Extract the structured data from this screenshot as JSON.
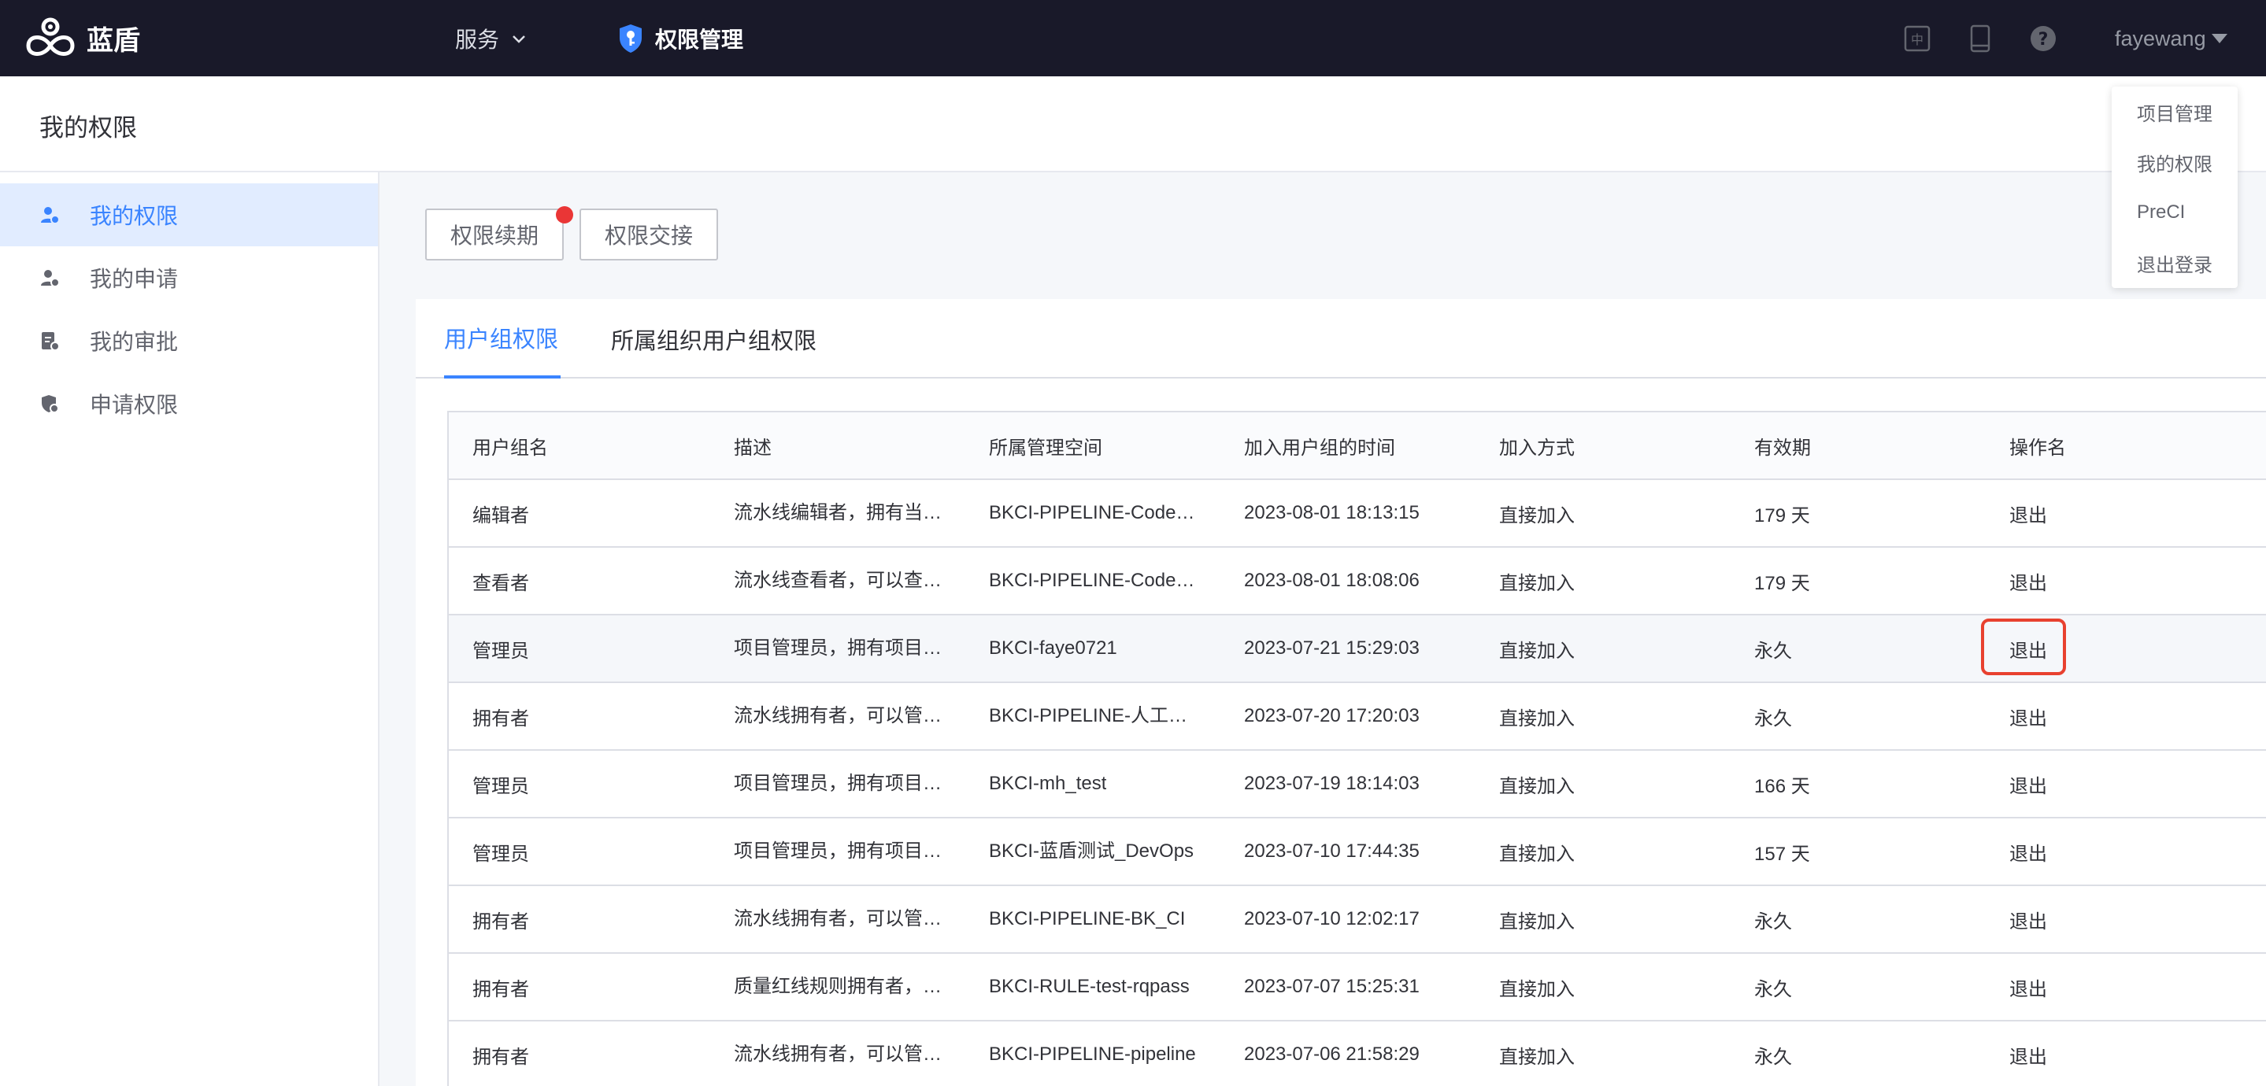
{
  "topbar": {
    "brand_name": "蓝盾",
    "service_label": "服务",
    "module_title": "权限管理",
    "icons": [
      "language-icon",
      "mobile-icon",
      "help-icon"
    ],
    "username": "fayewang"
  },
  "user_dropdown": {
    "items": [
      "项目管理",
      "我的权限",
      "PreCI",
      "退出登录"
    ]
  },
  "header": {
    "title": "我的权限"
  },
  "sidebar": {
    "items": [
      {
        "label": "我的权限",
        "icon": "user-shield-icon",
        "active": true
      },
      {
        "label": "我的申请",
        "icon": "user-apply-icon",
        "active": false
      },
      {
        "label": "我的审批",
        "icon": "approval-doc-icon",
        "active": false
      },
      {
        "label": "申请权限",
        "icon": "lock-shield-icon",
        "active": false
      }
    ]
  },
  "actions": {
    "renew_label": "权限续期",
    "handover_label": "权限交接"
  },
  "tabs": [
    {
      "label": "用户组权限",
      "active": true
    },
    {
      "label": "所属组织用户组权限",
      "active": false
    }
  ],
  "table": {
    "columns": [
      "用户组名",
      "描述",
      "所属管理空间",
      "加入用户组的时间",
      "加入方式",
      "有效期",
      "操作名"
    ],
    "rows": [
      {
        "group": "编辑者",
        "desc": "流水线编辑者，拥有当前流水线编辑权限",
        "space": "BKCI-PIPELINE-CodeCC",
        "time": "2023-08-01 18:13:15",
        "method": "直接加入",
        "validity": "179 天",
        "action": "退出"
      },
      {
        "group": "查看者",
        "desc": "流水线查看者，可以查看当前流水线",
        "space": "BKCI-PIPELINE-CodeCC",
        "time": "2023-08-01 18:08:06",
        "method": "直接加入",
        "validity": "179 天",
        "action": "退出"
      },
      {
        "group": "管理员",
        "desc": "项目管理员，拥有项目内所有权限",
        "space": "BKCI-faye0721",
        "time": "2023-07-21 15:29:03",
        "method": "直接加入",
        "validity": "永久",
        "action": "退出"
      },
      {
        "group": "拥有者",
        "desc": "流水线拥有者，可以管理当前流水线",
        "space": "BKCI-PIPELINE-人工审核",
        "time": "2023-07-20 17:20:03",
        "method": "直接加入",
        "validity": "永久",
        "action": "退出"
      },
      {
        "group": "管理员",
        "desc": "项目管理员，拥有项目内所有权限",
        "space": "BKCI-mh_test",
        "time": "2023-07-19 18:14:03",
        "method": "直接加入",
        "validity": "166 天",
        "action": "退出"
      },
      {
        "group": "管理员",
        "desc": "项目管理员，拥有项目内所有权限",
        "space": "BKCI-蓝盾测试_DevOps",
        "time": "2023-07-10 17:44:35",
        "method": "直接加入",
        "validity": "157 天",
        "action": "退出"
      },
      {
        "group": "拥有者",
        "desc": "流水线拥有者，可以管理当前流水线",
        "space": "BKCI-PIPELINE-BK_CI",
        "time": "2023-07-10 12:02:17",
        "method": "直接加入",
        "validity": "永久",
        "action": "退出"
      },
      {
        "group": "拥有者",
        "desc": "质量红线规则拥有者，可以管理规则",
        "space": "BKCI-RULE-test-rqpass",
        "time": "2023-07-07 15:25:31",
        "method": "直接加入",
        "validity": "永久",
        "action": "退出"
      },
      {
        "group": "拥有者",
        "desc": "流水线拥有者，可以管理当前流水线",
        "space": "BKCI-PIPELINE-pipeline",
        "time": "2023-07-06 21:58:29",
        "method": "直接加入",
        "validity": "永久",
        "action": "退出"
      }
    ]
  },
  "colors": {
    "topbar_bg": "#191929",
    "accent": "#3a84ff",
    "badge_red": "#ea3636",
    "highlight_red": "#e8412f"
  }
}
